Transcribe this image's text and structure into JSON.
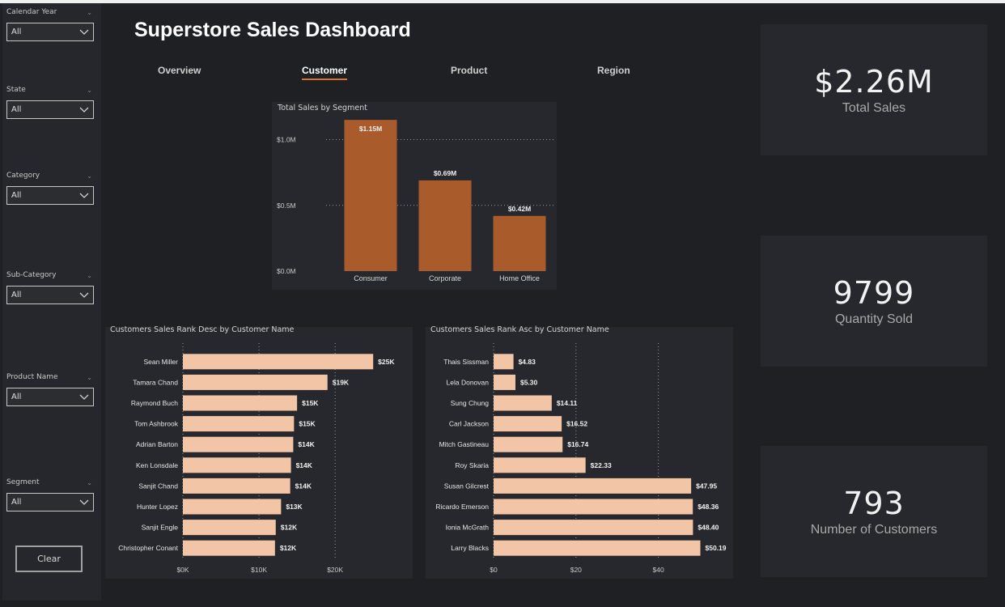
{
  "sidebar": {
    "slicers": [
      {
        "label": "Calendar Year",
        "value": "All"
      },
      {
        "label": "State",
        "value": "All"
      },
      {
        "label": "Category",
        "value": "All"
      },
      {
        "label": "Sub-Category",
        "value": "All"
      },
      {
        "label": "Product Name",
        "value": "All"
      },
      {
        "label": "Segment",
        "value": "All"
      }
    ],
    "clear_label": "Clear"
  },
  "header": {
    "title": "Superstore Sales Dashboard",
    "tabs": [
      "Overview",
      "Customer",
      "Product",
      "Region"
    ],
    "active_tab": "Customer"
  },
  "colors": {
    "segment_bar": "#a95b2b",
    "customer_bar": "#f2c5a6",
    "tab_underline": "#d9732e"
  },
  "kpis": [
    {
      "value": "$2.26M",
      "label": "Total Sales"
    },
    {
      "value": "9799",
      "label": "Quantity Sold"
    },
    {
      "value": "793",
      "label": "Number of Customers"
    }
  ],
  "chart_data": [
    {
      "type": "bar",
      "title": "Total Sales by Segment",
      "categories": [
        "Consumer",
        "Corporate",
        "Home Office"
      ],
      "values": [
        1.15,
        0.69,
        0.42
      ],
      "value_labels": [
        "$1.15M",
        "$0.69M",
        "$0.42M"
      ],
      "ylim": [
        0,
        1.2
      ],
      "yticks": [
        0,
        0.5,
        1.0
      ],
      "ytick_labels": [
        "$0.0M",
        "$0.5M",
        "$1.0M"
      ],
      "grid": true
    },
    {
      "type": "bar",
      "orientation": "horizontal",
      "title": "Customers Sales Rank Desc by Customer Name",
      "categories": [
        "Sean Miller",
        "Tamara Chand",
        "Raymond Buch",
        "Tom Ashbrook",
        "Adrian Barton",
        "Ken Lonsdale",
        "Sanjit Chand",
        "Hunter Lopez",
        "Sanjit Engle",
        "Christopher Conant"
      ],
      "values": [
        25000,
        19000,
        15000,
        14600,
        14500,
        14200,
        14100,
        12900,
        12200,
        12100
      ],
      "value_labels": [
        "$25K",
        "$19K",
        "$15K",
        "$15K",
        "$14K",
        "$14K",
        "$14K",
        "$13K",
        "$12K",
        "$12K"
      ],
      "xlim": [
        0,
        27000
      ],
      "xticks": [
        0,
        10000,
        20000
      ],
      "xtick_labels": [
        "$0K",
        "$10K",
        "$20K"
      ],
      "grid": true
    },
    {
      "type": "bar",
      "orientation": "horizontal",
      "title": "Customers Sales Rank Asc by Customer Name",
      "categories": [
        "Thais Sissman",
        "Lela Donovan",
        "Sung Chung",
        "Carl Jackson",
        "Mitch Gastineau",
        "Roy Skaria",
        "Susan Gilcrest",
        "Ricardo Emerson",
        "Ionia McGrath",
        "Larry Blacks"
      ],
      "values": [
        4.83,
        5.3,
        14.11,
        16.52,
        16.74,
        22.33,
        47.95,
        48.36,
        48.4,
        50.19
      ],
      "value_labels": [
        "$4.83",
        "$5.30",
        "$14.11",
        "$16.52",
        "$16.74",
        "$22.33",
        "$47.95",
        "$48.36",
        "$48.40",
        "$50.19"
      ],
      "xlim": [
        0,
        55
      ],
      "xticks": [
        0,
        20,
        40
      ],
      "xtick_labels": [
        "$0",
        "$20",
        "$40"
      ],
      "grid": true
    }
  ]
}
